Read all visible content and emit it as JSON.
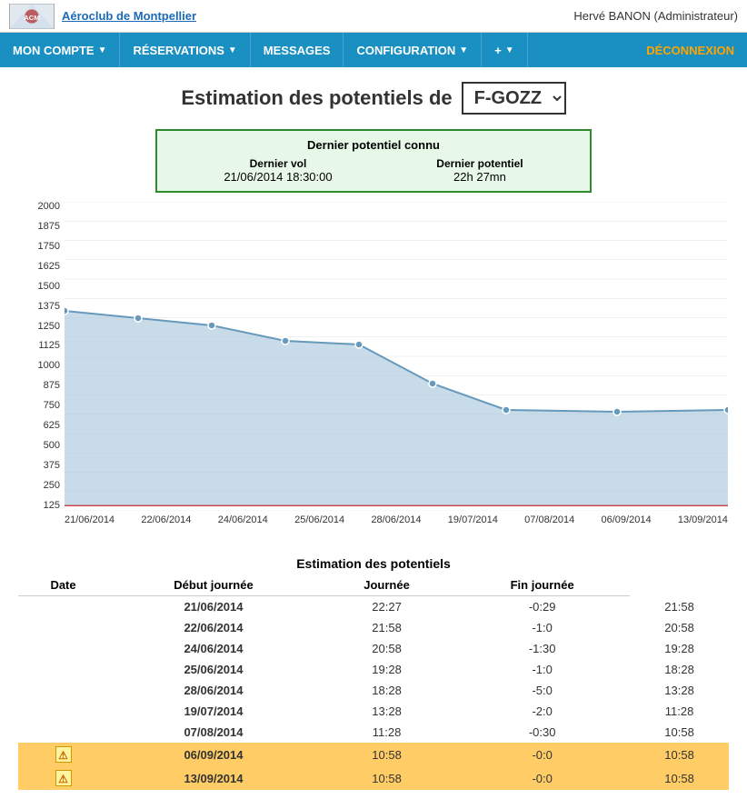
{
  "header": {
    "logo_alt": "Aéroclub de Montpellier",
    "logo_text": "Aéroclub de Montpellier",
    "user": "Hervé  BANON (Administrateur)"
  },
  "nav": {
    "items": [
      {
        "label": "MON COMPTE",
        "has_arrow": true
      },
      {
        "label": "RÉSERVATIONS",
        "has_arrow": true
      },
      {
        "label": "MESSAGES",
        "has_arrow": false
      },
      {
        "label": "CONFIGURATION",
        "has_arrow": true
      },
      {
        "label": "+",
        "has_arrow": true
      }
    ],
    "deconnexion": "DÉCONNEXION"
  },
  "page": {
    "title_prefix": "Estimation des potentiels de",
    "aircraft": "F-GOZZ"
  },
  "info_box": {
    "title": "Dernier potentiel connu",
    "col1_header": "Dernier vol",
    "col1_value": "21/06/2014 18:30:00",
    "col2_header": "Dernier potentiel",
    "col2_value": "22h 27mn"
  },
  "chart": {
    "y_labels": [
      "2000",
      "1875",
      "1750",
      "1625",
      "1500",
      "1375",
      "1250",
      "1125",
      "1000",
      "875",
      "750",
      "625",
      "500",
      "375",
      "250",
      "125"
    ],
    "x_labels": [
      "21/06/2014",
      "22/06/2014",
      "24/06/2014",
      "25/06/2014",
      "28/06/2014",
      "19/07/2014",
      "07/08/2014",
      "06/09/2014",
      "13/09/2014"
    ]
  },
  "table": {
    "section_title": "Estimation des potentiels",
    "col_date": "Date",
    "col_debut": "Début journée",
    "col_journee": "Journée",
    "col_fin": "Fin journée",
    "rows": [
      {
        "date": "21/06/2014",
        "debut": "22:27",
        "journee": "-0:29",
        "fin": "21:58",
        "warn": false,
        "highlight": false
      },
      {
        "date": "22/06/2014",
        "debut": "21:58",
        "journee": "-1:0",
        "fin": "20:58",
        "warn": false,
        "highlight": false
      },
      {
        "date": "24/06/2014",
        "debut": "20:58",
        "journee": "-1:30",
        "fin": "19:28",
        "warn": false,
        "highlight": false
      },
      {
        "date": "25/06/2014",
        "debut": "19:28",
        "journee": "-1:0",
        "fin": "18:28",
        "warn": false,
        "highlight": false
      },
      {
        "date": "28/06/2014",
        "debut": "18:28",
        "journee": "-5:0",
        "fin": "13:28",
        "warn": false,
        "highlight": false
      },
      {
        "date": "19/07/2014",
        "debut": "13:28",
        "journee": "-2:0",
        "fin": "11:28",
        "warn": false,
        "highlight": false
      },
      {
        "date": "07/08/2014",
        "debut": "11:28",
        "journee": "-0:30",
        "fin": "10:58",
        "warn": false,
        "highlight": false
      },
      {
        "date": "06/09/2014",
        "debut": "10:58",
        "journee": "-0:0",
        "fin": "10:58",
        "warn": true,
        "highlight": true
      },
      {
        "date": "13/09/2014",
        "debut": "10:58",
        "journee": "-0:0",
        "fin": "10:58",
        "warn": true,
        "highlight": true
      }
    ]
  }
}
